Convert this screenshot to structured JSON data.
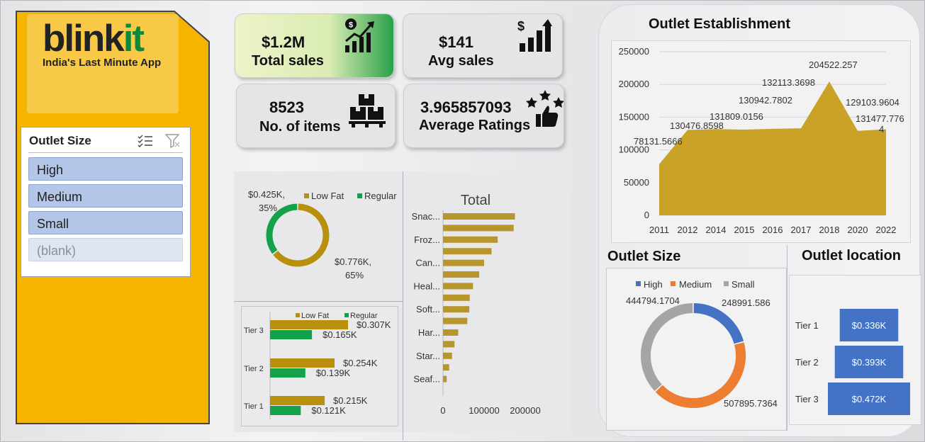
{
  "brand": {
    "logo_main": "blink",
    "logo_accent": "it",
    "tagline": "India's Last Minute App",
    "accent": "#0c8a3c",
    "panel_color": "#f4b400"
  },
  "slicer": {
    "title": "Outlet Size",
    "items": [
      {
        "label": "High",
        "selected": true
      },
      {
        "label": "Medium",
        "selected": true
      },
      {
        "label": "Small",
        "selected": true
      },
      {
        "label": "(blank)",
        "selected": false
      }
    ]
  },
  "kpis": {
    "total_sales": {
      "value": "$1.2M",
      "label": "Total sales",
      "icon": "sales-growth-icon"
    },
    "avg_sales": {
      "value": "$141",
      "label": "Avg sales",
      "icon": "dollar-bars-icon"
    },
    "items": {
      "value": "8523",
      "label": "No. of items",
      "icon": "boxes-pallet-icon"
    },
    "ratings": {
      "value": "3.965857093",
      "label": "Average Ratings",
      "icon": "stars-thumbs-up-icon"
    }
  },
  "colors": {
    "low_fat": "#b8900c",
    "regular": "#13a14a",
    "bar": "#b8962e",
    "area": "#c9a227",
    "high": "#4472c4",
    "medium": "#ed7d31",
    "small": "#a5a5a5"
  },
  "chart_data": [
    {
      "id": "fat_content",
      "type": "pie",
      "donut": true,
      "legend": [
        "Low Fat",
        "Regular"
      ],
      "legend_position": "top-right",
      "values": [
        0.776,
        0.425
      ],
      "labels": [
        {
          "value": "$0.776K,",
          "pct": "65%"
        },
        {
          "value": "$0.425K,",
          "pct": "35%"
        }
      ]
    },
    {
      "id": "fat_by_tier",
      "type": "bar",
      "orientation": "horizontal",
      "categories": [
        "Tier 3",
        "Tier 2",
        "Tier 1"
      ],
      "legend": [
        "Low Fat",
        "Regular"
      ],
      "legend_position": "top",
      "series": [
        {
          "name": "Low Fat",
          "values": [
            0.307,
            0.254,
            0.215
          ],
          "labels": [
            "$0.307K",
            "$0.254K",
            "$0.215K"
          ]
        },
        {
          "name": "Regular",
          "values": [
            0.165,
            0.139,
            0.121
          ],
          "labels": [
            "$0.165K",
            "$0.139K",
            "$0.121K"
          ]
        }
      ],
      "xlim": [
        0,
        0.35
      ]
    },
    {
      "id": "item_type",
      "type": "bar",
      "orientation": "horizontal",
      "title": "Total",
      "category_labels": [
        "Snac...",
        "",
        "Froz...",
        "",
        "Can...",
        "",
        "Heal...",
        "",
        "Soft...",
        "",
        "Har...",
        "",
        "Star...",
        "",
        "Seaf..."
      ],
      "values": [
        175000,
        172000,
        133000,
        118000,
        100000,
        88000,
        73000,
        65000,
        64000,
        59000,
        37000,
        28000,
        22000,
        15000,
        9000
      ],
      "ticks": [
        "0",
        "100000",
        "200000"
      ],
      "xlim": [
        0,
        200000
      ]
    },
    {
      "id": "outlet_establishment",
      "type": "area",
      "title": "Outlet Establishment",
      "x": [
        "2011",
        "2012",
        "2014",
        "2015",
        "2016",
        "2017",
        "2018",
        "2020",
        "2022"
      ],
      "values": [
        78131.5666,
        130476.8598,
        131809.0156,
        130942.7802,
        132113.3698,
        133000,
        204522.257,
        129103.9604,
        131477.7764
      ],
      "point_labels": [
        "78131.5666",
        "130476.8598",
        "131809.0156",
        "130942.7802",
        "132113.3698",
        "",
        "204522.257",
        "129103.9604",
        "131477.776|4"
      ],
      "yticks": [
        "250000",
        "200000",
        "150000",
        "100000",
        "50000",
        "0"
      ],
      "ylim": [
        0,
        250000
      ],
      "grid": true
    },
    {
      "id": "outlet_size",
      "type": "pie",
      "donut": true,
      "title": "Outlet Size",
      "legend": [
        "High",
        "Medium",
        "Small"
      ],
      "legend_position": "top",
      "values": [
        248991.586,
        507895.7364,
        444794.1704
      ],
      "labels": [
        "248991.586",
        "507895.7364",
        "444794.1704"
      ]
    },
    {
      "id": "outlet_location",
      "type": "bar",
      "orientation": "horizontal",
      "title": "Outlet location",
      "categories": [
        "Tier 1",
        "Tier 2",
        "Tier 3"
      ],
      "values": [
        0.336,
        0.393,
        0.472
      ],
      "labels": [
        "$0.336K",
        "$0.393K",
        "$0.472K"
      ],
      "xlim": [
        0,
        0.472
      ]
    }
  ]
}
